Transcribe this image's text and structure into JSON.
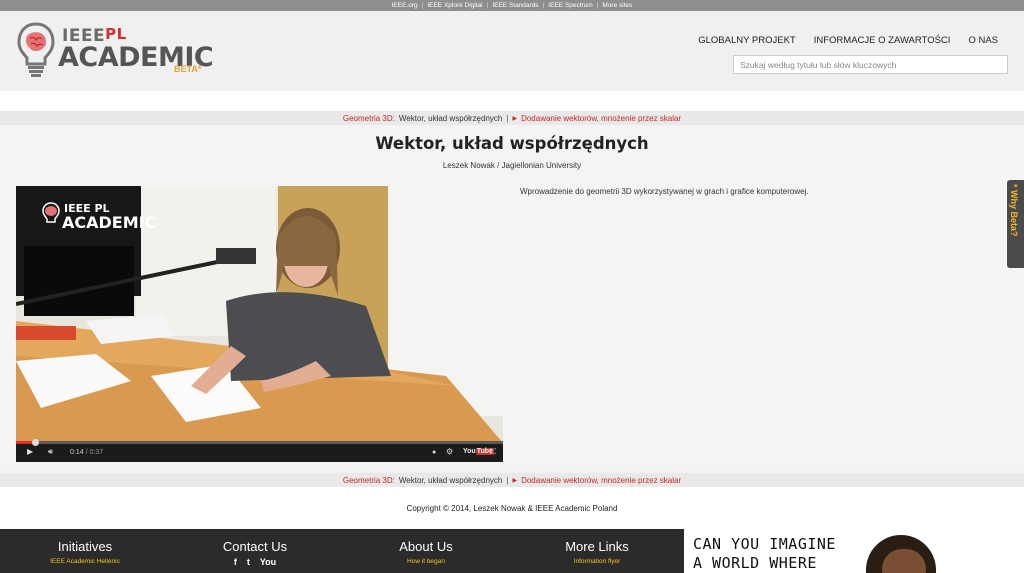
{
  "topbar": {
    "links": [
      "IEEE.org",
      "IEEE Xplore Digital",
      "IEEE Standards",
      "IEEE Spectrum",
      "More sites"
    ]
  },
  "logo": {
    "ieee": "IEEE",
    "pl": "PL",
    "academic": "ACADEMIC",
    "beta": "BETA*"
  },
  "nav": {
    "items": [
      "GLOBALNY PROJEKT",
      "INFORMACJE O ZAWARTOŚCI",
      "O NAS"
    ]
  },
  "search": {
    "placeholder": "Szukaj według tytułu lub słów kluczowych"
  },
  "breadcrumb": {
    "category": "Geometria 3D:",
    "current": "Wektor, układ współrzędnych",
    "pipe": "|",
    "next": "Dodawanie wektorów, mnożenie przez skalar"
  },
  "lecture": {
    "title": "Wektor, układ współrzędnych",
    "author": "Leszek Nowak / Jagiellonian University",
    "description": "Wprowadzenie do geometrii 3D wykorzystywanej w grach i grafice komputerowej."
  },
  "video": {
    "overlay_ieee": "IEEE PL",
    "overlay_academic": "ACADEMIC",
    "current_time": "0:14",
    "duration": "0:37",
    "progress_fraction": 0.04,
    "youtube_you": "You",
    "youtube_tube": "Tube"
  },
  "why_beta": "* Why Beta?",
  "copyright": "Copyright © 2014, Leszek Nowak & IEEE Academic Poland",
  "footer": {
    "columns": [
      {
        "heading": "Initiatives",
        "link": "IEEE Academic Hellenic"
      },
      {
        "heading": "Contact Us",
        "link": ""
      },
      {
        "heading": "About Us",
        "link": "How it began"
      },
      {
        "heading": "More Links",
        "link": "Information flyer"
      }
    ],
    "social": [
      "f",
      "t",
      "You"
    ]
  },
  "ad": {
    "line1": "CAN YOU IMAGINE",
    "line2": "A WORLD WHERE"
  },
  "colors": {
    "accent_red": "#c62828",
    "beta_orange": "#e8a23a",
    "footer_link": "#f5c518",
    "footer_bg": "#2b2b2b"
  }
}
